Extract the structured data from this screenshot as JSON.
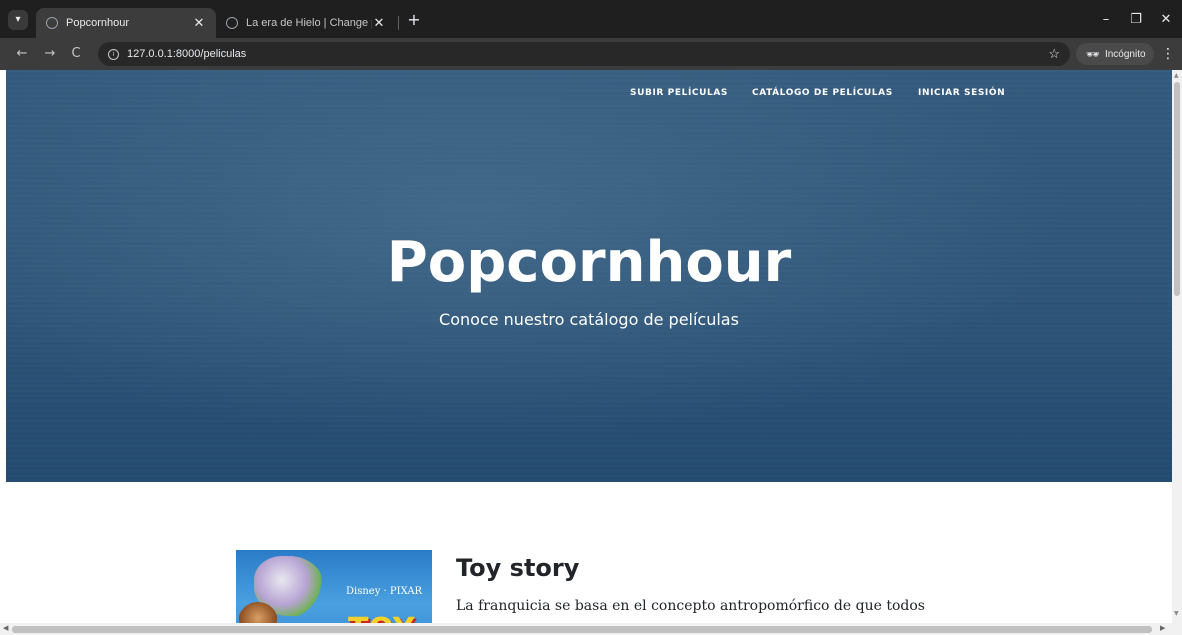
{
  "browser": {
    "tabs": [
      {
        "title": "Popcornhour",
        "active": true
      },
      {
        "title": "La era de Hielo | Change proye",
        "active": false
      }
    ],
    "tab_search_icon": "▾",
    "new_tab_icon": "+",
    "close_icon": "✕",
    "window_controls": {
      "minimize": "–",
      "restore": "❐",
      "close": "✕"
    },
    "nav": {
      "back": "←",
      "forward": "→",
      "reload": "C"
    },
    "url": "127.0.0.1:8000/peliculas",
    "bookmark_icon": "☆",
    "incognito_label": "Incógnito",
    "incognito_icon": "🕶",
    "menu_icon": "⋮"
  },
  "site": {
    "nav": [
      {
        "label": "SUBIR PELÍCULAS"
      },
      {
        "label": "CATÁLOGO DE PELÍCULAS"
      },
      {
        "label": "INICIAR SESIÓN"
      }
    ],
    "hero": {
      "title": "Popcornhour",
      "subtitle": "Conoce nuestro catálogo de películas"
    },
    "movies": [
      {
        "title": "Toy story",
        "description": "La franquicia se basa en el concepto antropomórfico de que todos",
        "poster_brand": "Disney · PIXAR",
        "poster_text": "TOY"
      }
    ]
  },
  "colors": {
    "hero_bg": "#2e5478",
    "chrome_bg": "#1f1f1f",
    "toolbar_bg": "#3c3c3c"
  }
}
